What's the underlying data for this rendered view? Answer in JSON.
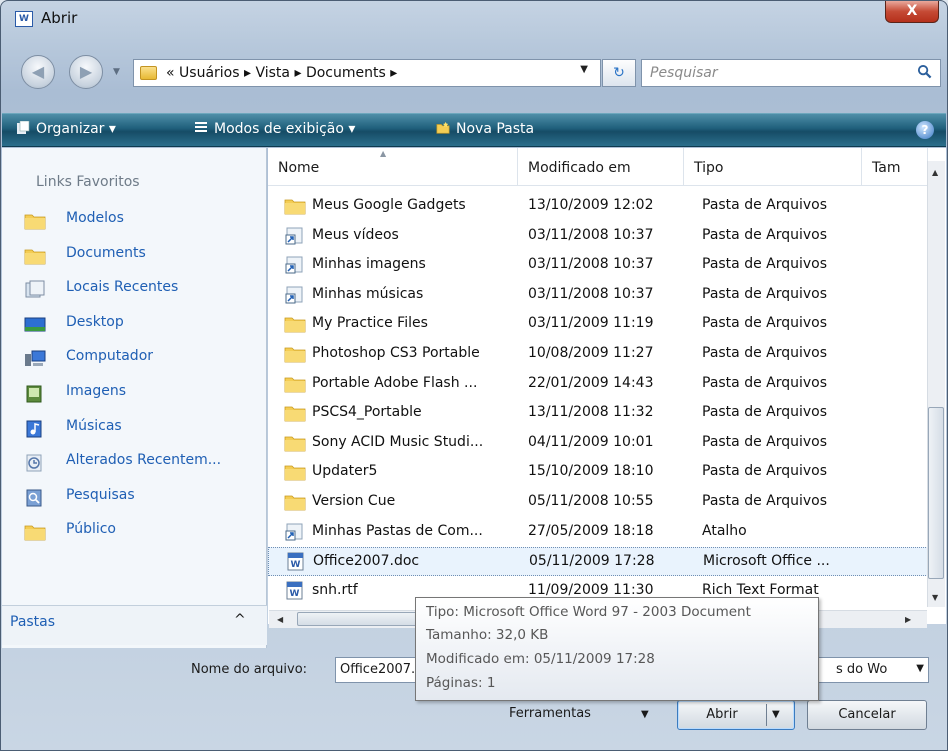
{
  "window": {
    "title": "Abrir",
    "close_label": "X"
  },
  "address": {
    "path_prefix": "«",
    "crumbs": [
      "Usuários",
      "Vista",
      "Documents"
    ],
    "separator": "▸",
    "search_placeholder": "Pesquisar"
  },
  "toolbar": {
    "organize": "Organizar ▾",
    "views": "Modos de exibição ▾",
    "new_folder": "Nova Pasta",
    "help": "?"
  },
  "left_pane": {
    "favorites_header": "Links Favoritos",
    "items": [
      {
        "label": "Modelos",
        "icon": "folder-icon"
      },
      {
        "label": "Documents",
        "icon": "folder-icon"
      },
      {
        "label": "Locais Recentes",
        "icon": "recent-places-icon"
      },
      {
        "label": "Desktop",
        "icon": "desktop-icon"
      },
      {
        "label": "Computador",
        "icon": "computer-icon"
      },
      {
        "label": "Imagens",
        "icon": "pictures-icon"
      },
      {
        "label": "Músicas",
        "icon": "music-icon"
      },
      {
        "label": "Alterados Recentem...",
        "icon": "recently-changed-icon"
      },
      {
        "label": "Pesquisas",
        "icon": "searches-icon"
      },
      {
        "label": "Público",
        "icon": "folder-icon"
      }
    ],
    "folders_label": "Pastas",
    "folders_chevron": "^"
  },
  "columns": [
    "Nome",
    "Modificado em",
    "Tipo",
    "Tam"
  ],
  "files": [
    {
      "name": "Meus Google Gadgets",
      "modified": "13/10/2009 12:02",
      "type": "Pasta de Arquivos",
      "icon": "folder-icon"
    },
    {
      "name": "Meus vídeos",
      "modified": "03/11/2008 10:37",
      "type": "Pasta de Arquivos",
      "icon": "shortcut-icon"
    },
    {
      "name": "Minhas imagens",
      "modified": "03/11/2008 10:37",
      "type": "Pasta de Arquivos",
      "icon": "shortcut-icon"
    },
    {
      "name": "Minhas músicas",
      "modified": "03/11/2008 10:37",
      "type": "Pasta de Arquivos",
      "icon": "shortcut-icon"
    },
    {
      "name": "My Practice Files",
      "modified": "03/11/2009 11:19",
      "type": "Pasta de Arquivos",
      "icon": "folder-icon"
    },
    {
      "name": "Photoshop CS3 Portable",
      "modified": "10/08/2009 11:27",
      "type": "Pasta de Arquivos",
      "icon": "folder-icon"
    },
    {
      "name": "Portable Adobe Flash ...",
      "modified": "22/01/2009 14:43",
      "type": "Pasta de Arquivos",
      "icon": "folder-icon"
    },
    {
      "name": "PSCS4_Portable",
      "modified": "13/11/2008 11:32",
      "type": "Pasta de Arquivos",
      "icon": "folder-icon"
    },
    {
      "name": "Sony ACID Music Studi...",
      "modified": "04/11/2009 10:01",
      "type": "Pasta de Arquivos",
      "icon": "folder-icon"
    },
    {
      "name": "Updater5",
      "modified": "15/10/2009 18:10",
      "type": "Pasta de Arquivos",
      "icon": "folder-icon"
    },
    {
      "name": "Version Cue",
      "modified": "05/11/2008 10:55",
      "type": "Pasta de Arquivos",
      "icon": "folder-icon"
    },
    {
      "name": "Minhas Pastas de Com...",
      "modified": "27/05/2009 18:18",
      "type": "Atalho",
      "icon": "shortcut-icon"
    },
    {
      "name": "Office2007.doc",
      "modified": "05/11/2009 17:28",
      "type": "Microsoft Office ...",
      "icon": "word-doc-icon",
      "selected": true
    },
    {
      "name": "snh.rtf",
      "modified": "11/09/2009 11:30",
      "type": "Rich Text Format",
      "icon": "word-doc-icon"
    }
  ],
  "tooltip": {
    "lines": [
      "Tipo: Microsoft Office Word 97 - 2003 Document",
      "Tamanho: 32,0 KB",
      "Modificado em: 05/11/2009 17:28",
      "Páginas: 1"
    ]
  },
  "bottom": {
    "filename_label": "Nome do arquivo:",
    "filename_value": "Office2007.doc",
    "filetype_value": "s do Wo",
    "tools_label": "Ferramentas",
    "open_label": "Abrir",
    "cancel_label": "Cancelar"
  },
  "colors": {
    "link": "#1f5fb4",
    "toolbar": "#1f5f7b",
    "selection": "#e9f3fd"
  }
}
